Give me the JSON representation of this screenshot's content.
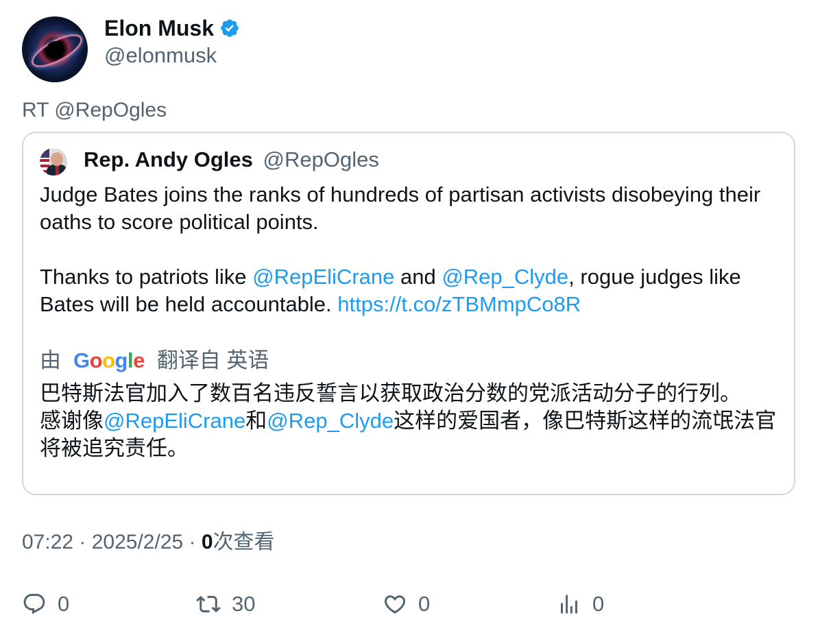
{
  "tweet": {
    "author_name": "Elon Musk",
    "author_handle": "@elonmusk",
    "rt_text": "RT @RepOgles",
    "timestamp": "07:22 · 2025/2/25 · ",
    "views_count": "0",
    "views_label": "次查看"
  },
  "quoted": {
    "author_name": "Rep. Andy Ogles",
    "author_handle": "@RepOgles",
    "para1": "Judge Bates joins the ranks of hundreds of partisan activists disobeying their oaths to score political points.",
    "para2_a": "Thanks to patriots like ",
    "mention1": "@RepEliCrane",
    "para2_b": " and ",
    "mention2": "@Rep_Clyde",
    "para2_c": ", rogue judges like Bates will be held accountable. ",
    "url": "https://t.co/zTBMmpCo8R",
    "translate_prefix": "由",
    "translate_suffix": "翻译自 英语",
    "translation_line1": "巴特斯法官加入了数百名违反誓言以获取政治分数的党派活动分子的行列。",
    "translation_a": "感谢像",
    "translation_mention1": "@RepEliCrane",
    "translation_b": "和",
    "translation_mention2": "@Rep_Clyde",
    "translation_c": "这样的爱国者，像巴特斯这样的流氓法官将被追究责任。"
  },
  "google_logo": {
    "letters": [
      "G",
      "o",
      "o",
      "g",
      "l",
      "e"
    ]
  },
  "actions": {
    "replies": "0",
    "retweets": "30",
    "likes": "0",
    "views": "0"
  },
  "colors": {
    "link": "#1d9bf0",
    "muted": "#536471",
    "verified": "#1d9bf0",
    "border": "#cfd9de"
  },
  "icons": [
    "verified-badge-icon",
    "reply-icon",
    "retweet-icon",
    "like-icon",
    "views-icon",
    "google-logo"
  ]
}
